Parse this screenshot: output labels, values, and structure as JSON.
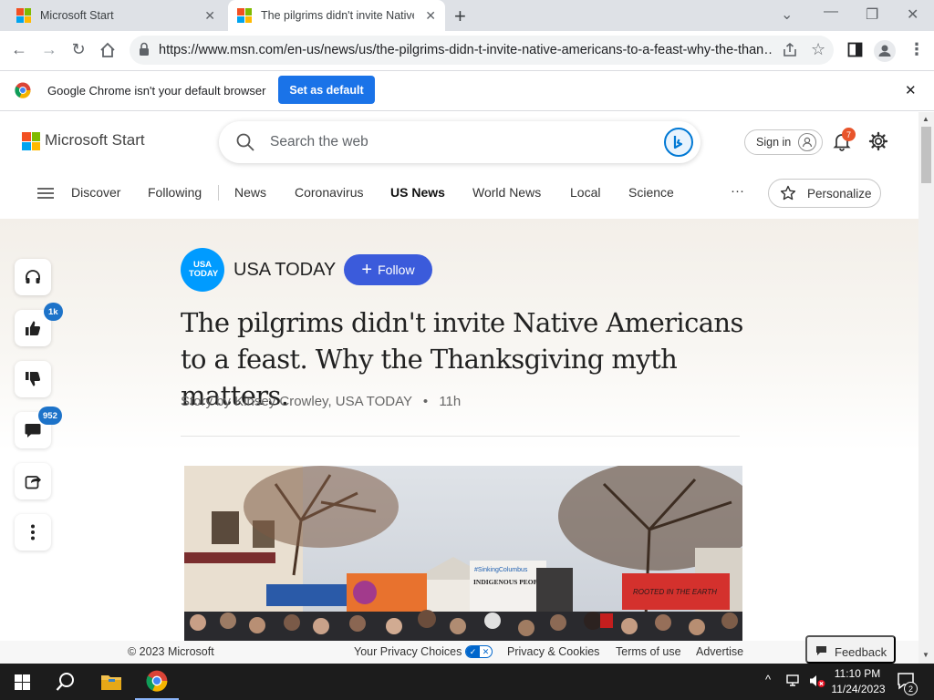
{
  "browser": {
    "tabs": [
      {
        "title": "Microsoft Start",
        "active": false
      },
      {
        "title": "The pilgrims didn't invite Native",
        "active": true
      }
    ],
    "url": "https://www.msn.com/en-us/news/us/the-pilgrims-didn-t-invite-native-americans-to-a-feast-why-the-than…",
    "infobar": {
      "message": "Google Chrome isn't your default browser",
      "button": "Set as default"
    }
  },
  "site": {
    "brand": "Microsoft Start",
    "search_placeholder": "Search the web",
    "signin": "Sign in",
    "notifications_count": "7",
    "nav": [
      "Discover",
      "Following",
      "News",
      "Coronavirus",
      "US News",
      "World News",
      "Local",
      "Science"
    ],
    "nav_active": "US News",
    "more": "···",
    "personalize": "Personalize"
  },
  "rail": {
    "like_count": "1k",
    "comment_count": "952"
  },
  "article": {
    "publisher_logo_text": "USA TODAY",
    "publisher": "USA TODAY",
    "follow": "Follow",
    "headline": "The pilgrims didn't invite Native Americans to a feast. Why the Thanksgiving myth matters.",
    "byline": "Story by Kinsey Crowley, USA TODAY",
    "age": "11h",
    "hero_signs": {
      "sign1": "#SinkingColumbus",
      "sign2": "INDIGENOUS PEOPLES DAY",
      "sign3": "ROOTED IN THE EARTH"
    }
  },
  "footer": {
    "copyright": "© 2023 Microsoft",
    "links": [
      "Your Privacy Choices",
      "Privacy & Cookies",
      "Terms of use",
      "Advertise"
    ],
    "feedback": "Feedback"
  },
  "taskbar": {
    "time": "11:10 PM",
    "date": "11/24/2023",
    "notif_count": "2"
  },
  "colors": {
    "accent_blue": "#1a73e8",
    "follow_blue": "#3b5bdb",
    "bing_blue": "#0078d4",
    "badge_blue": "#1d73c9",
    "notif_orange": "#e8542b"
  }
}
